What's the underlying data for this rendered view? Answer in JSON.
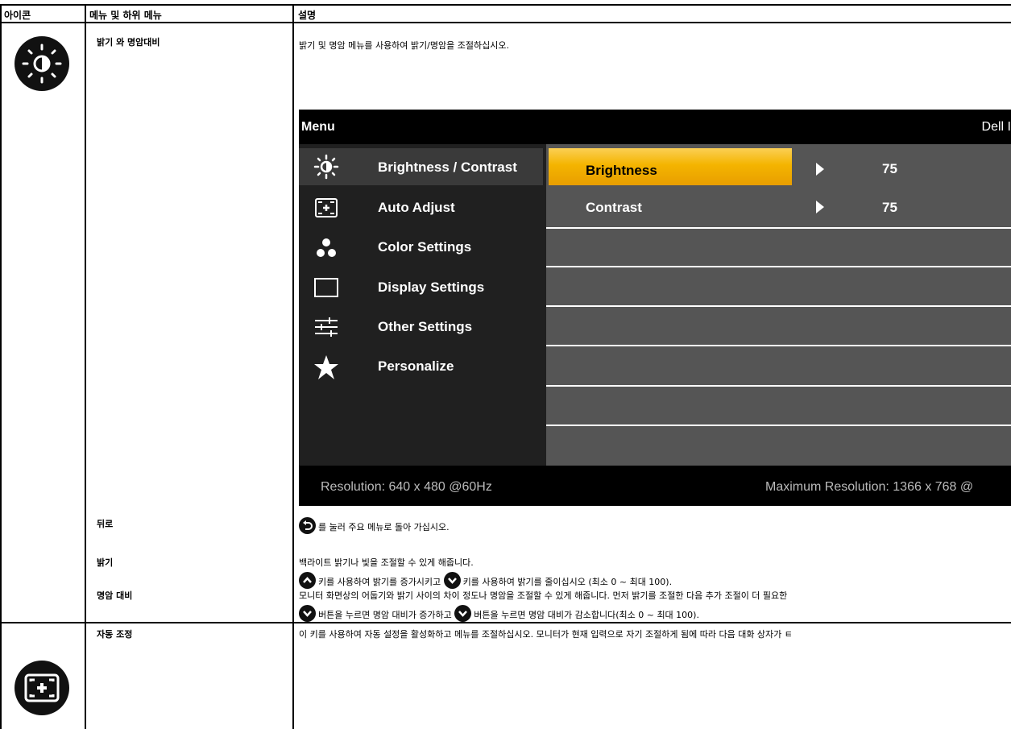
{
  "header": {
    "col_icon": "아이콘",
    "col_menu": "메뉴 및 하위 메뉴",
    "col_desc": "설명"
  },
  "rows": {
    "brightness_contrast": {
      "title": "밝기 와 명암대비",
      "desc": "밝기 및 명암 메뉴를 사용하여 밝기/명암을 조절하십시오.",
      "icon": "brightness-icon"
    },
    "back": {
      "label": "뒤로",
      "desc": "를 눌러 주요 메뉴로 돌아 가십시오."
    },
    "brightness": {
      "label": "밝기",
      "desc1": "백라이트 밝기나 빛을 조절할 수 있게 해줍니다.",
      "desc2a": "키를 사용하여 밝기를 증가시키고",
      "desc2b": "키를 사용하여 밝기를 줄이십시오 (최소 0 ~ 최대 100)."
    },
    "contrast": {
      "label": "명암 대비",
      "desc1": "모니터 화면상의 어둡기와 밝기 사이의 차이 정도나 명암을 조절할 수 있게 해줍니다. 먼저 밝기를 조절한 다음 추가 조절이 더 필요한",
      "desc2a": "버튼을 누르면 명암 대비가 증가하고",
      "desc2b": "버튼을 누르면 명암 대비가 감소합니다(최소 0 ~ 최대 100)."
    },
    "auto_adjust": {
      "title": "자동 조정",
      "desc": "이 키를 사용하여 자동 설정을 활성화하고 메뉴를 조절하십시오. 모니터가 현재 입력으로 자기 조절하게 됨에 따라 다음 대화 상자가 ㅌ",
      "icon": "auto-adjust-icon"
    }
  },
  "osd": {
    "title": "Menu",
    "brand": "Dell I",
    "menu": [
      {
        "label": "Brightness / Contrast",
        "icon": "brightness-icon"
      },
      {
        "label": "Auto Adjust",
        "icon": "auto-adjust-icon"
      },
      {
        "label": "Color Settings",
        "icon": "color-dots-icon"
      },
      {
        "label": "Display Settings",
        "icon": "display-rect-icon"
      },
      {
        "label": "Other Settings",
        "icon": "sliders-icon"
      },
      {
        "label": "Personalize",
        "icon": "star-icon"
      }
    ],
    "sub": [
      {
        "label": "Brightness",
        "value": "75"
      },
      {
        "label": "Contrast",
        "value": "75"
      }
    ],
    "resolution": "Resolution: 640 x 480 @60Hz",
    "max_resolution": "Maximum Resolution: 1366 x 768 @",
    "colors": {
      "highlight": "#f4b400",
      "panel": "#555555",
      "bg": "#202020"
    }
  }
}
